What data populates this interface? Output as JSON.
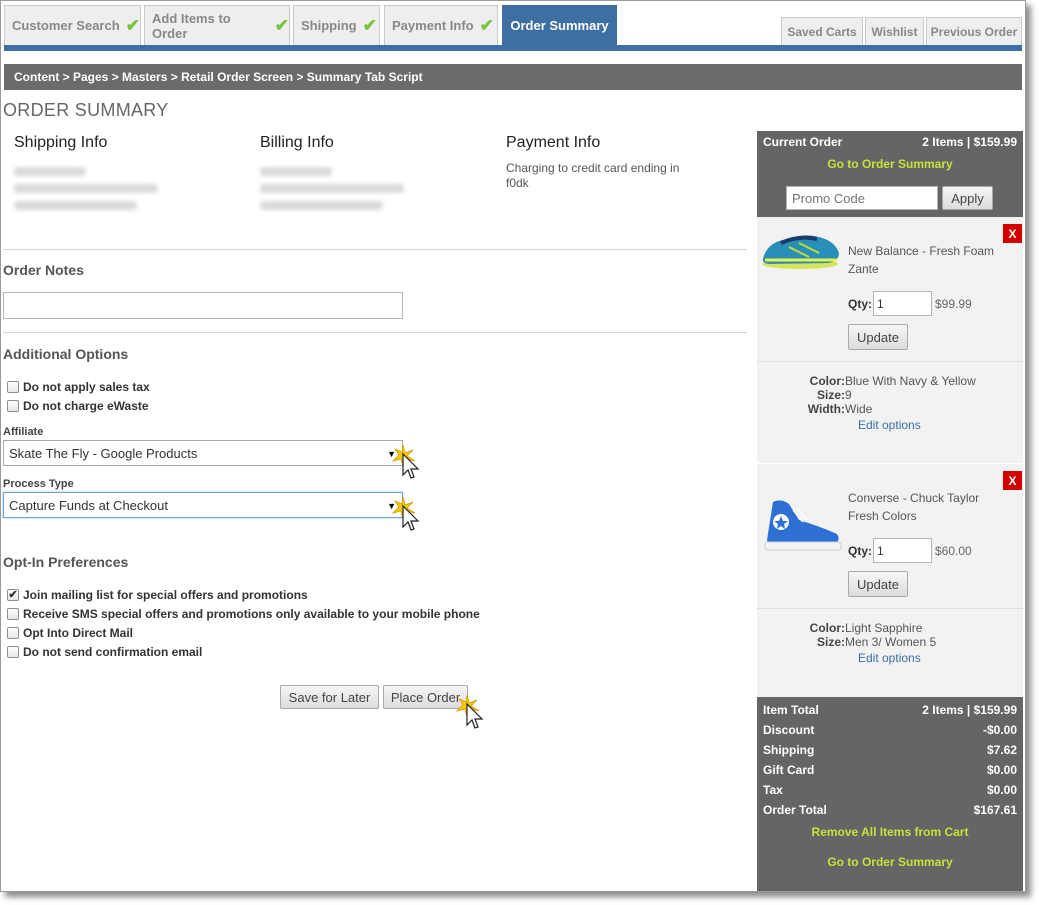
{
  "tabs": {
    "customer_search": "Customer Search",
    "add_items": "Add Items to Order",
    "shipping": "Shipping",
    "payment_info": "Payment Info",
    "order_summary": "Order Summary",
    "check": "✔",
    "saved_carts": "Saved Carts",
    "wishlist": "Wishlist",
    "previous_order": "Previous Order"
  },
  "breadcrumb": "Content > Pages > Masters > Retail Order Screen > Summary Tab Script",
  "page_title": "ORDER SUMMARY",
  "info": {
    "shipping_title": "Shipping Info",
    "billing_title": "Billing Info",
    "payment_title": "Payment Info",
    "payment_text": "Charging to credit card ending in f0dk"
  },
  "order_notes": {
    "title": "Order Notes",
    "value": ""
  },
  "additional_options": {
    "title": "Additional Options",
    "no_sales_tax": "Do not apply sales tax",
    "no_ewaste": "Do not charge eWaste",
    "affiliate_label": "Affiliate",
    "affiliate_value": "Skate The Fly - Google Products",
    "process_label": "Process Type",
    "process_value": "Capture Funds at Checkout"
  },
  "opt_in": {
    "title": "Opt-In Preferences",
    "mailing": "Join mailing list for special offers and promotions",
    "mailing_checked": true,
    "sms": "Receive SMS special offers and promotions only available to your mobile phone",
    "direct_mail": "Opt Into Direct Mail",
    "no_confirm": "Do not send confirmation email"
  },
  "actions": {
    "save_later": "Save for Later",
    "place_order": "Place Order"
  },
  "cart": {
    "current_order_label": "Current Order",
    "current_order_summary": "2 Items | $159.99",
    "go_to_summary": "Go to Order Summary",
    "promo_placeholder": "Promo Code",
    "apply": "Apply",
    "remove": "X",
    "qty_label": "Qty:",
    "update": "Update",
    "edit_options": "Edit options",
    "items": [
      {
        "name": "New Balance - Fresh Foam Zante",
        "qty": "1",
        "price": "$99.99",
        "options": [
          {
            "key": "Color:",
            "value": "Blue With Navy & Yellow"
          },
          {
            "key": "Size:",
            "value": "9"
          },
          {
            "key": "Width:",
            "value": "Wide"
          }
        ]
      },
      {
        "name": "Converse - Chuck Taylor Fresh Colors",
        "qty": "1",
        "price": "$60.00",
        "options": [
          {
            "key": "Color:",
            "value": "Light Sapphire"
          },
          {
            "key": "Size:",
            "value": "Men 3/ Women 5"
          }
        ]
      }
    ],
    "totals": [
      {
        "label": "Item Total",
        "value": "2 Items | $159.99"
      },
      {
        "label": "Discount",
        "value": "-$0.00"
      },
      {
        "label": "Shipping",
        "value": "$7.62"
      },
      {
        "label": "Gift Card",
        "value": "$0.00"
      },
      {
        "label": "Tax",
        "value": "$0.00"
      },
      {
        "label": "Order Total",
        "value": "$167.61"
      }
    ],
    "remove_all": "Remove All Items from Cart",
    "go_to_summary_bottom": "Go to Order Summary"
  },
  "colors": {
    "active_tab": "#3d6fa3",
    "check_green": "#7cc142",
    "panel_gray": "#656565",
    "link_yellow": "#c6e33c",
    "remove_red": "#d40000"
  }
}
